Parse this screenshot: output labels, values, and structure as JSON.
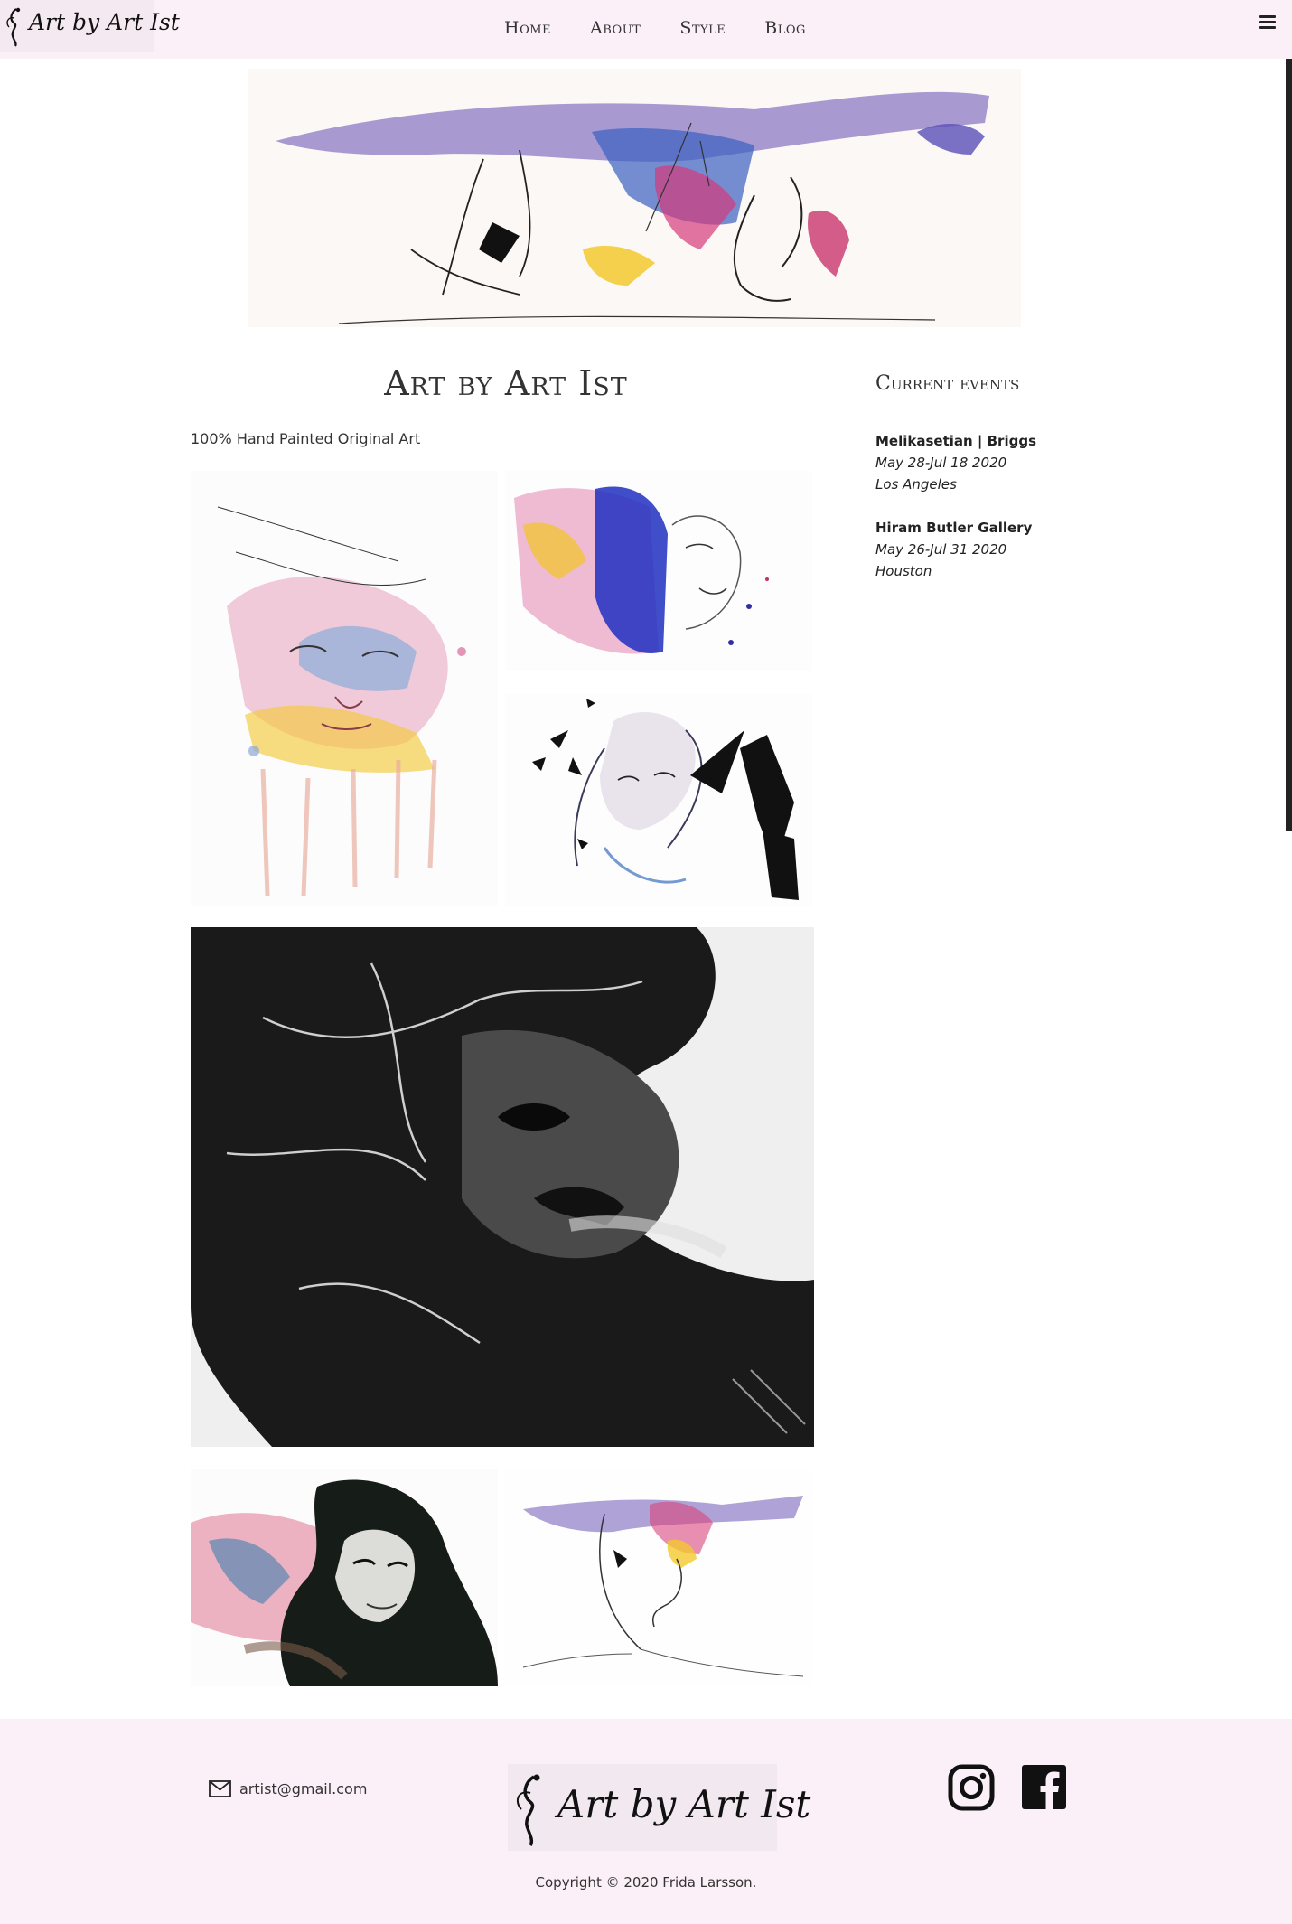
{
  "header": {
    "logo_text": "Art by Art Ist",
    "nav": [
      "Home",
      "About",
      "Style",
      "Blog"
    ],
    "menu_icon": "hamburger-icon"
  },
  "main": {
    "title": "Art by Art Ist",
    "tagline": "100% Hand Painted Original Art"
  },
  "events": {
    "title": "Current events",
    "items": [
      {
        "name": "Melikasetian | Briggs",
        "dates": "May 28-Jul 18 2020",
        "city": "Los Angeles"
      },
      {
        "name": "Hiram Butler Gallery",
        "dates": "May 26-Jul 31 2020",
        "city": "Houston"
      }
    ]
  },
  "footer": {
    "email": "artist@gmail.com",
    "email_icon": "envelope-icon",
    "logo_text": "Art by Art Ist",
    "social": [
      "instagram-icon",
      "facebook-icon"
    ],
    "copyright": "Copyright © 2020 Frida Larsson."
  },
  "colors": {
    "header_bg": "#fbf0f7",
    "footer_bg": "#fbf0f7",
    "text": "#333333"
  }
}
